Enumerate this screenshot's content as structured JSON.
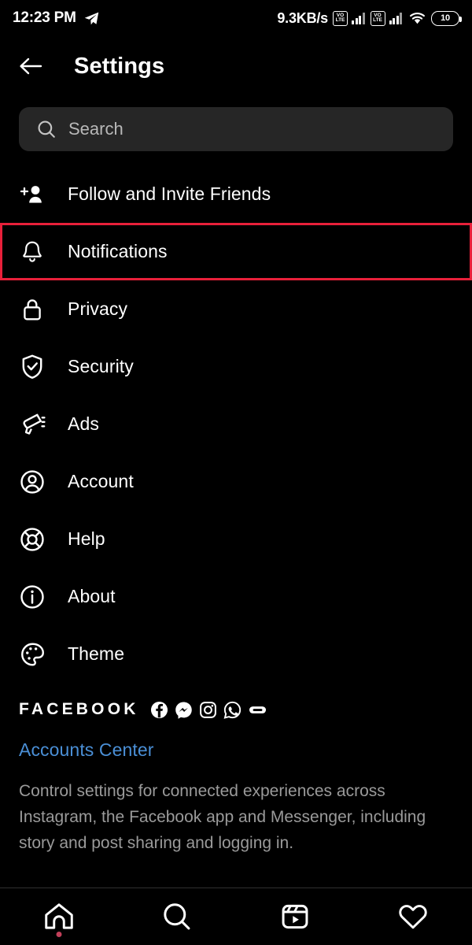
{
  "status_bar": {
    "time": "12:23 PM",
    "send_icon": "telegram-send-icon",
    "network_speed": "9.3KB/s",
    "sim1_badge": "VO",
    "sim1_badge2": "LTE",
    "sim2_badge": "VO",
    "sim2_badge2": "LTE",
    "wifi_icon": "wifi-icon",
    "battery_level": "10"
  },
  "header": {
    "back_icon": "back-arrow-icon",
    "title": "Settings"
  },
  "search": {
    "icon": "search-icon",
    "placeholder": "Search",
    "value": ""
  },
  "settings": {
    "items": [
      {
        "label": "Follow and Invite Friends",
        "icon": "person-add-icon",
        "highlighted": false
      },
      {
        "label": "Notifications",
        "icon": "bell-icon",
        "highlighted": true
      },
      {
        "label": "Privacy",
        "icon": "lock-icon",
        "highlighted": false
      },
      {
        "label": "Security",
        "icon": "shield-check-icon",
        "highlighted": false
      },
      {
        "label": "Ads",
        "icon": "megaphone-icon",
        "highlighted": false
      },
      {
        "label": "Account",
        "icon": "person-circle-icon",
        "highlighted": false
      },
      {
        "label": "Help",
        "icon": "lifebuoy-icon",
        "highlighted": false
      },
      {
        "label": "About",
        "icon": "info-circle-icon",
        "highlighted": false
      },
      {
        "label": "Theme",
        "icon": "palette-icon",
        "highlighted": false
      }
    ]
  },
  "facebook_section": {
    "title": "FACEBOOK",
    "app_icons": [
      "facebook-icon",
      "messenger-icon",
      "instagram-icon",
      "whatsapp-icon",
      "portal-icon"
    ],
    "accounts_center_link": "Accounts Center",
    "description": "Control settings for connected experiences across Instagram, the Facebook app and Messenger, including story and post sharing and logging in."
  },
  "bottom_nav": {
    "items": [
      {
        "icon": "home-icon",
        "has_dot": true
      },
      {
        "icon": "search-icon",
        "has_dot": false
      },
      {
        "icon": "reels-icon",
        "has_dot": false
      },
      {
        "icon": "heart-icon",
        "has_dot": false
      }
    ]
  },
  "colors": {
    "background": "#000000",
    "search_field": "#262626",
    "highlight_red": "#e8203a",
    "link_blue": "#4a8fd6",
    "muted_text": "#9a9a9a",
    "nav_dot": "#c2405a"
  }
}
